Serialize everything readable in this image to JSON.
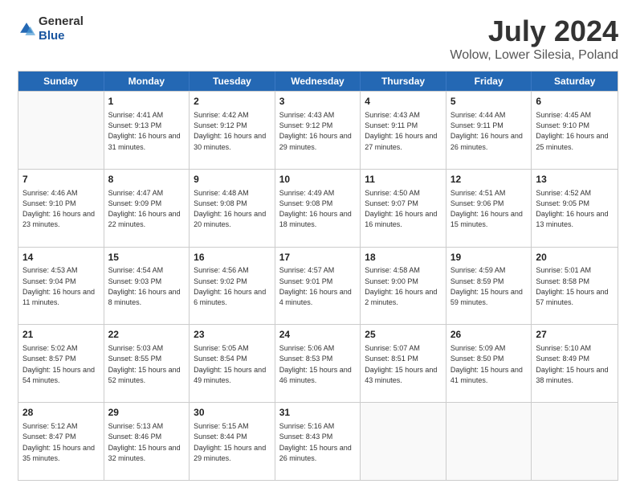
{
  "logo": {
    "general": "General",
    "blue": "Blue"
  },
  "title": "July 2024",
  "subtitle": "Wolow, Lower Silesia, Poland",
  "days": [
    "Sunday",
    "Monday",
    "Tuesday",
    "Wednesday",
    "Thursday",
    "Friday",
    "Saturday"
  ],
  "weeks": [
    [
      {
        "day": "",
        "sunrise": "",
        "sunset": "",
        "daylight": ""
      },
      {
        "day": "1",
        "sunrise": "Sunrise: 4:41 AM",
        "sunset": "Sunset: 9:13 PM",
        "daylight": "Daylight: 16 hours and 31 minutes."
      },
      {
        "day": "2",
        "sunrise": "Sunrise: 4:42 AM",
        "sunset": "Sunset: 9:12 PM",
        "daylight": "Daylight: 16 hours and 30 minutes."
      },
      {
        "day": "3",
        "sunrise": "Sunrise: 4:43 AM",
        "sunset": "Sunset: 9:12 PM",
        "daylight": "Daylight: 16 hours and 29 minutes."
      },
      {
        "day": "4",
        "sunrise": "Sunrise: 4:43 AM",
        "sunset": "Sunset: 9:11 PM",
        "daylight": "Daylight: 16 hours and 27 minutes."
      },
      {
        "day": "5",
        "sunrise": "Sunrise: 4:44 AM",
        "sunset": "Sunset: 9:11 PM",
        "daylight": "Daylight: 16 hours and 26 minutes."
      },
      {
        "day": "6",
        "sunrise": "Sunrise: 4:45 AM",
        "sunset": "Sunset: 9:10 PM",
        "daylight": "Daylight: 16 hours and 25 minutes."
      }
    ],
    [
      {
        "day": "7",
        "sunrise": "Sunrise: 4:46 AM",
        "sunset": "Sunset: 9:10 PM",
        "daylight": "Daylight: 16 hours and 23 minutes."
      },
      {
        "day": "8",
        "sunrise": "Sunrise: 4:47 AM",
        "sunset": "Sunset: 9:09 PM",
        "daylight": "Daylight: 16 hours and 22 minutes."
      },
      {
        "day": "9",
        "sunrise": "Sunrise: 4:48 AM",
        "sunset": "Sunset: 9:08 PM",
        "daylight": "Daylight: 16 hours and 20 minutes."
      },
      {
        "day": "10",
        "sunrise": "Sunrise: 4:49 AM",
        "sunset": "Sunset: 9:08 PM",
        "daylight": "Daylight: 16 hours and 18 minutes."
      },
      {
        "day": "11",
        "sunrise": "Sunrise: 4:50 AM",
        "sunset": "Sunset: 9:07 PM",
        "daylight": "Daylight: 16 hours and 16 minutes."
      },
      {
        "day": "12",
        "sunrise": "Sunrise: 4:51 AM",
        "sunset": "Sunset: 9:06 PM",
        "daylight": "Daylight: 16 hours and 15 minutes."
      },
      {
        "day": "13",
        "sunrise": "Sunrise: 4:52 AM",
        "sunset": "Sunset: 9:05 PM",
        "daylight": "Daylight: 16 hours and 13 minutes."
      }
    ],
    [
      {
        "day": "14",
        "sunrise": "Sunrise: 4:53 AM",
        "sunset": "Sunset: 9:04 PM",
        "daylight": "Daylight: 16 hours and 11 minutes."
      },
      {
        "day": "15",
        "sunrise": "Sunrise: 4:54 AM",
        "sunset": "Sunset: 9:03 PM",
        "daylight": "Daylight: 16 hours and 8 minutes."
      },
      {
        "day": "16",
        "sunrise": "Sunrise: 4:56 AM",
        "sunset": "Sunset: 9:02 PM",
        "daylight": "Daylight: 16 hours and 6 minutes."
      },
      {
        "day": "17",
        "sunrise": "Sunrise: 4:57 AM",
        "sunset": "Sunset: 9:01 PM",
        "daylight": "Daylight: 16 hours and 4 minutes."
      },
      {
        "day": "18",
        "sunrise": "Sunrise: 4:58 AM",
        "sunset": "Sunset: 9:00 PM",
        "daylight": "Daylight: 16 hours and 2 minutes."
      },
      {
        "day": "19",
        "sunrise": "Sunrise: 4:59 AM",
        "sunset": "Sunset: 8:59 PM",
        "daylight": "Daylight: 15 hours and 59 minutes."
      },
      {
        "day": "20",
        "sunrise": "Sunrise: 5:01 AM",
        "sunset": "Sunset: 8:58 PM",
        "daylight": "Daylight: 15 hours and 57 minutes."
      }
    ],
    [
      {
        "day": "21",
        "sunrise": "Sunrise: 5:02 AM",
        "sunset": "Sunset: 8:57 PM",
        "daylight": "Daylight: 15 hours and 54 minutes."
      },
      {
        "day": "22",
        "sunrise": "Sunrise: 5:03 AM",
        "sunset": "Sunset: 8:55 PM",
        "daylight": "Daylight: 15 hours and 52 minutes."
      },
      {
        "day": "23",
        "sunrise": "Sunrise: 5:05 AM",
        "sunset": "Sunset: 8:54 PM",
        "daylight": "Daylight: 15 hours and 49 minutes."
      },
      {
        "day": "24",
        "sunrise": "Sunrise: 5:06 AM",
        "sunset": "Sunset: 8:53 PM",
        "daylight": "Daylight: 15 hours and 46 minutes."
      },
      {
        "day": "25",
        "sunrise": "Sunrise: 5:07 AM",
        "sunset": "Sunset: 8:51 PM",
        "daylight": "Daylight: 15 hours and 43 minutes."
      },
      {
        "day": "26",
        "sunrise": "Sunrise: 5:09 AM",
        "sunset": "Sunset: 8:50 PM",
        "daylight": "Daylight: 15 hours and 41 minutes."
      },
      {
        "day": "27",
        "sunrise": "Sunrise: 5:10 AM",
        "sunset": "Sunset: 8:49 PM",
        "daylight": "Daylight: 15 hours and 38 minutes."
      }
    ],
    [
      {
        "day": "28",
        "sunrise": "Sunrise: 5:12 AM",
        "sunset": "Sunset: 8:47 PM",
        "daylight": "Daylight: 15 hours and 35 minutes."
      },
      {
        "day": "29",
        "sunrise": "Sunrise: 5:13 AM",
        "sunset": "Sunset: 8:46 PM",
        "daylight": "Daylight: 15 hours and 32 minutes."
      },
      {
        "day": "30",
        "sunrise": "Sunrise: 5:15 AM",
        "sunset": "Sunset: 8:44 PM",
        "daylight": "Daylight: 15 hours and 29 minutes."
      },
      {
        "day": "31",
        "sunrise": "Sunrise: 5:16 AM",
        "sunset": "Sunset: 8:43 PM",
        "daylight": "Daylight: 15 hours and 26 minutes."
      },
      {
        "day": "",
        "sunrise": "",
        "sunset": "",
        "daylight": ""
      },
      {
        "day": "",
        "sunrise": "",
        "sunset": "",
        "daylight": ""
      },
      {
        "day": "",
        "sunrise": "",
        "sunset": "",
        "daylight": ""
      }
    ]
  ]
}
